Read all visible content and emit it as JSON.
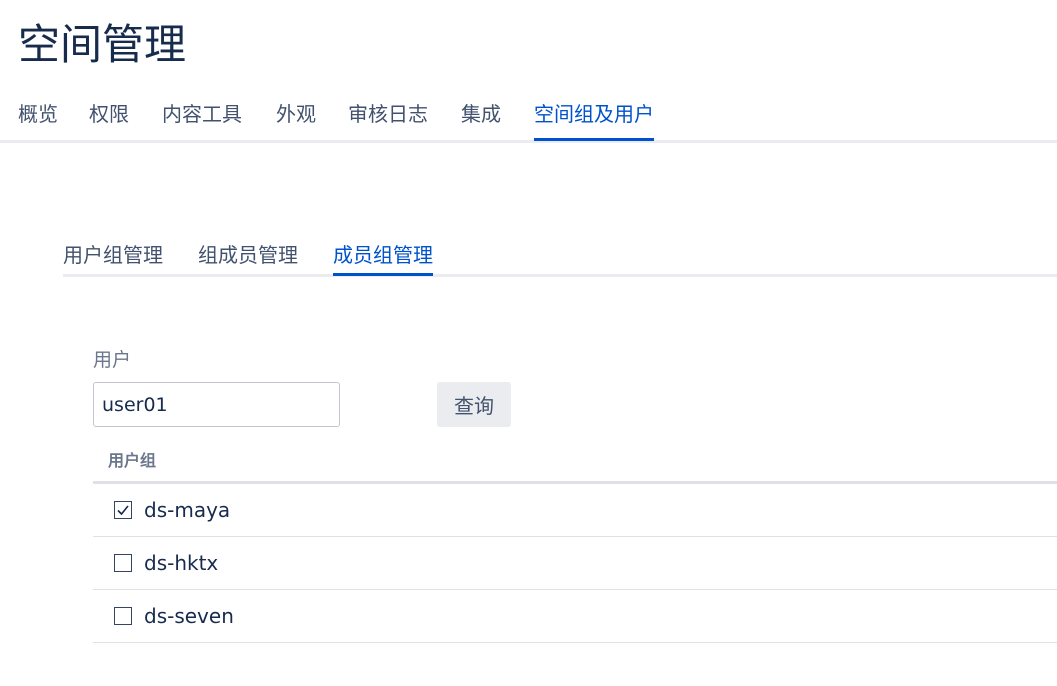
{
  "page": {
    "title": "空间管理"
  },
  "main_tabs": [
    {
      "label": "概览"
    },
    {
      "label": "权限"
    },
    {
      "label": "内容工具"
    },
    {
      "label": "外观"
    },
    {
      "label": "审核日志"
    },
    {
      "label": "集成"
    },
    {
      "label": "空间组及用户",
      "active": true
    }
  ],
  "sub_tabs": [
    {
      "label": "用户组管理"
    },
    {
      "label": "组成员管理"
    },
    {
      "label": "成员组管理",
      "active": true
    }
  ],
  "form": {
    "user_label": "用户",
    "user_value": "user01",
    "query_button": "查询"
  },
  "table": {
    "header": "用户组",
    "rows": [
      {
        "name": "ds-maya",
        "checked": true
      },
      {
        "name": "ds-hktx",
        "checked": false
      },
      {
        "name": "ds-seven",
        "checked": false
      }
    ]
  },
  "colors": {
    "accent": "#0052cc",
    "text": "#172b4d",
    "muted": "#6b778c",
    "border": "#dfe1e6"
  },
  "icons": {
    "checked": "check-icon"
  }
}
